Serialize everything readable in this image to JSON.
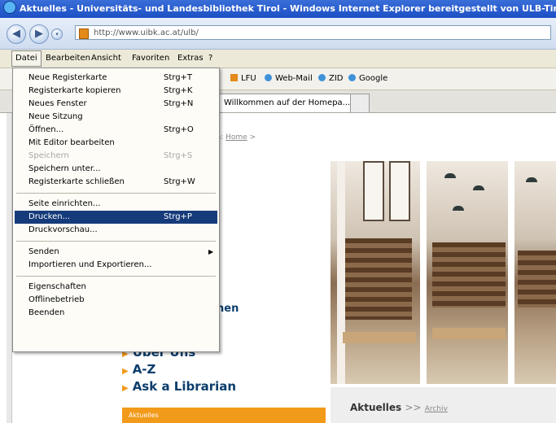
{
  "window": {
    "title": "Aktuelles - Universitäts- und Landesbibliothek Tirol - Windows Internet Explorer bereitgestellt von ULB-Tirol"
  },
  "address_bar": {
    "url": "http://www.uibk.ac.at/ulb/"
  },
  "menubar": {
    "items": [
      "Datei",
      "Bearbeiten",
      "Ansicht",
      "Favoriten",
      "Extras",
      "?"
    ]
  },
  "favorites_bar": {
    "items": [
      "LFU",
      "Web-Mail",
      "ZID",
      "Google"
    ]
  },
  "tabs": {
    "active_label": "Willkommen auf der Homepa..."
  },
  "file_menu": {
    "items": [
      {
        "label": "Neue Registerkarte",
        "shortcut": "Strg+T"
      },
      {
        "label": "Registerkarte kopieren",
        "shortcut": "Strg+K"
      },
      {
        "label": "Neues Fenster",
        "shortcut": "Strg+N"
      },
      {
        "label": "Neue Sitzung",
        "shortcut": ""
      },
      {
        "label": "Öffnen...",
        "shortcut": "Strg+O"
      },
      {
        "label": "Mit Editor bearbeiten",
        "shortcut": ""
      },
      {
        "label": "Speichern",
        "shortcut": "Strg+S"
      },
      {
        "label": "Speichern unter...",
        "shortcut": ""
      },
      {
        "label": "Registerkarte schließen",
        "shortcut": "Strg+W"
      },
      {
        "label": "Seite einrichten...",
        "shortcut": ""
      },
      {
        "label": "Drucken...",
        "shortcut": "Strg+P"
      },
      {
        "label": "Druckvorschau...",
        "shortcut": ""
      },
      {
        "label": "Senden",
        "shortcut": ""
      },
      {
        "label": "Importieren und Exportieren...",
        "shortcut": ""
      },
      {
        "label": "Eigenschaften",
        "shortcut": ""
      },
      {
        "label": "Offlinebetrieb",
        "shortcut": ""
      },
      {
        "label": "Beenden",
        "shortcut": ""
      }
    ]
  },
  "page": {
    "breadcrumb_prefix": "in:",
    "breadcrumb_link": "Home",
    "breadcrumb_sep": ">",
    "side_fragment": "hen",
    "links": [
      "Über Uns",
      "A-Z",
      "Ask a Librarian"
    ],
    "aktuelles_title": "Aktuelles",
    "aktuelles_sep": ">>",
    "aktuelles_link": "Archiv",
    "orange_bar_label": "Aktuelles"
  },
  "colors": {
    "title_bar": "#1c4fc4",
    "menu_highlight": "#163b7b",
    "accent_orange": "#f29a1a",
    "link_blue": "#0b3d6b"
  }
}
